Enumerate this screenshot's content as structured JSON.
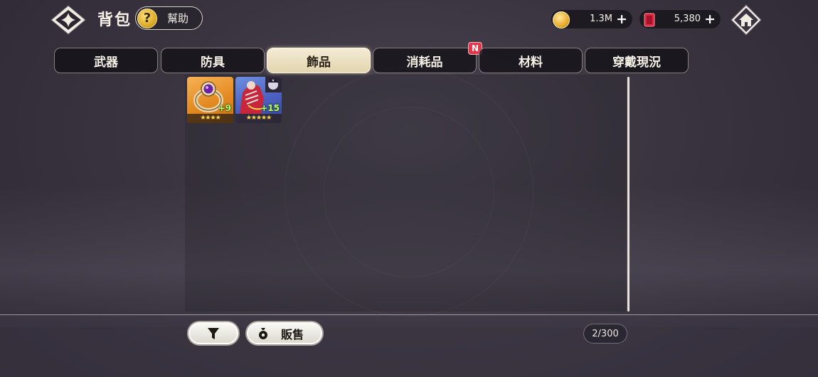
{
  "header": {
    "title": "背包",
    "help_label": "幫助"
  },
  "currencies": {
    "gold": "1.3M",
    "gem": "5,380"
  },
  "tabs": [
    {
      "label": "武器",
      "active": false
    },
    {
      "label": "防具",
      "active": false
    },
    {
      "label": "飾品",
      "active": true
    },
    {
      "label": "消耗品",
      "active": false,
      "badge": "N"
    },
    {
      "label": "材料",
      "active": false
    },
    {
      "label": "穿戴現況",
      "active": false
    }
  ],
  "items": [
    {
      "kind": "ring",
      "stars": "★★★★",
      "level": "+9"
    },
    {
      "kind": "character-accessory",
      "stars": "★★★★★",
      "level": "+15"
    }
  ],
  "footer": {
    "sell_label": "販售",
    "capacity": "2/300"
  },
  "colors": {
    "active_tab": "#e9dcb8",
    "new_badge": "#e2364a",
    "item_level": "#b8ff6a"
  },
  "icons": [
    "back-diamond-icon",
    "question-icon",
    "gold-coin-icon",
    "red-gem-icon",
    "plus-icon",
    "home-icon",
    "filter-funnel-icon",
    "money-bag-icon"
  ]
}
